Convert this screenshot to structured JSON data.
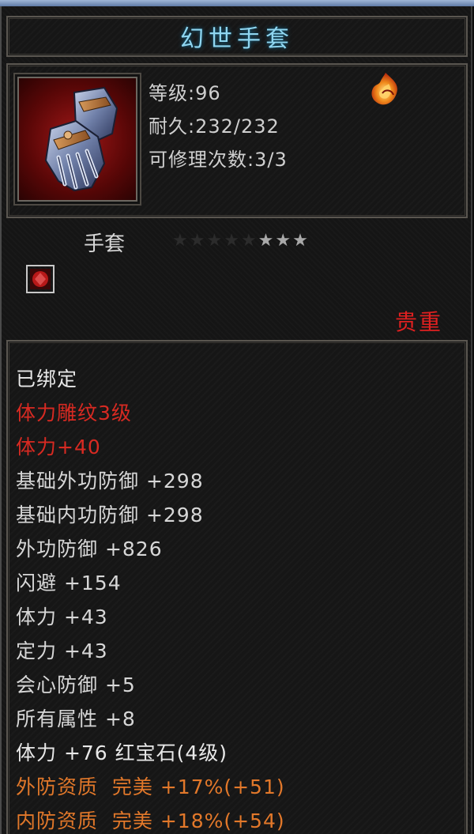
{
  "item": {
    "name": "幻世手套",
    "level": "等级:96",
    "durability": "耐久:232/232",
    "repairs": "可修理次数:3/3",
    "type": "手套",
    "rarity": "贵重",
    "star_count_total": 8,
    "star_count_lit": 3
  },
  "attributes": [
    {
      "text": "已绑定",
      "color": "white"
    },
    {
      "text": "体力雕纹3级",
      "color": "red"
    },
    {
      "text": "体力+40",
      "color": "red"
    },
    {
      "text": "基础外功防御 +298",
      "color": "stat"
    },
    {
      "text": "基础内功防御 +298",
      "color": "stat"
    },
    {
      "text": "外功防御 +826",
      "color": "stat"
    },
    {
      "text": "闪避 +154",
      "color": "stat"
    },
    {
      "text": "体力 +43",
      "color": "stat"
    },
    {
      "text": "定力 +43",
      "color": "stat"
    },
    {
      "text": "会心防御 +5",
      "color": "stat"
    },
    {
      "text": "所有属性 +8",
      "color": "stat"
    },
    {
      "text": "体力 +76 红宝石(4级)",
      "color": "white"
    },
    {
      "text": "外防资质  完美 +17%(+51)",
      "color": "orange"
    },
    {
      "text": "内防资质  完美 +18%(+54)",
      "color": "orange"
    }
  ],
  "icons": {
    "item_icon": "gauntlet-icon",
    "quality_icon": "flame-icon",
    "gem_icon": "gem-icon",
    "star_icon": "star-icon"
  },
  "colors": {
    "title": "#8fd6f0",
    "rarity": "#e02020",
    "bound": "#e8e8e8",
    "special": "#d82a22",
    "stat": "#d7d7d7",
    "quality": "#e2782a"
  }
}
